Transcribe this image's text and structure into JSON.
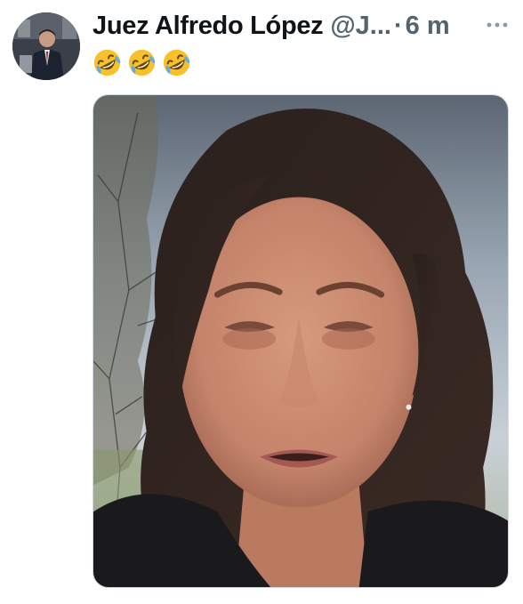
{
  "tweet": {
    "author": {
      "display_name": "Juez Alfredo López",
      "handle": "@J...",
      "avatar_icon": "avatar-photo"
    },
    "separator": "·",
    "timestamp": "6 m",
    "more_icon": "more-horizontal-icon",
    "text": "🤣🤣🤣",
    "emoji_icon": "rolling-on-floor-laughing-emoji",
    "media": {
      "type": "video-frame",
      "subject_icon": "person-face-photo"
    }
  },
  "colors": {
    "name": "#0f1419",
    "secondary": "#536471",
    "border": "#cfd9de",
    "emoji_face": "#f7c12d"
  }
}
